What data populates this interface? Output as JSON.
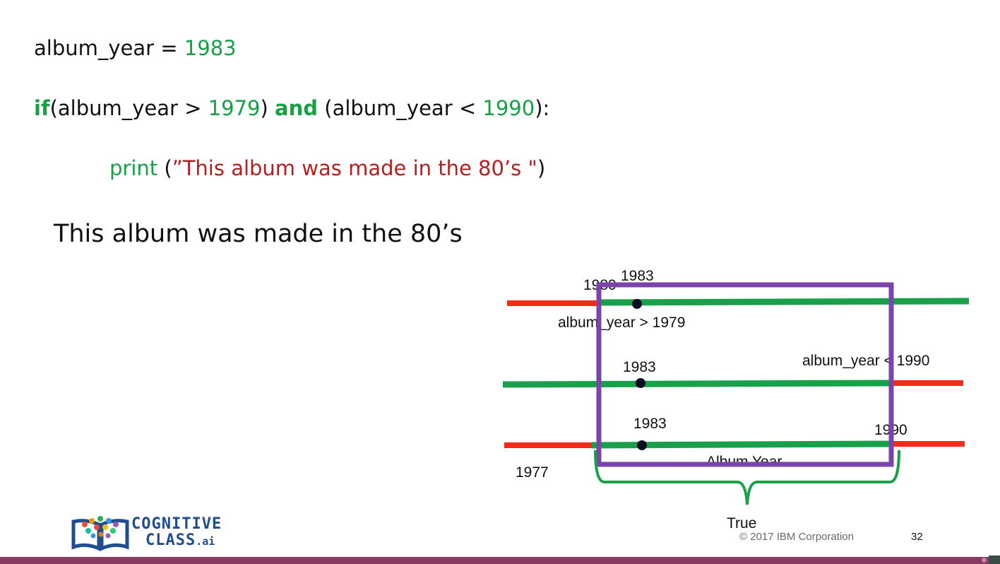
{
  "code": {
    "line1": {
      "var": "album_year = ",
      "value": "1983"
    },
    "line2": {
      "kw_if": "if",
      "p1": "(album_year > ",
      "n1": "1979",
      "p2": ") ",
      "kw_and": "and",
      "p3": " (album_year < ",
      "n2": "1990",
      "p4": "):"
    },
    "line3": {
      "fn": "print",
      "open": " (",
      "str": "”This album was made in the 80’s \"",
      "close": ")"
    }
  },
  "output": {
    "text": "This album was made in the 80’s"
  },
  "diagram": {
    "colors": {
      "true": "#1aa04a",
      "false": "#f52a1a",
      "box": "#7a44a8",
      "brace": "#1aa04a",
      "dot": "#0b0b22"
    },
    "row1": {
      "left_label": "1980",
      "value_label": "1983",
      "condition": "album_year > 1979"
    },
    "row2": {
      "value_label": "1983",
      "condition": "album_year < 1990"
    },
    "row3": {
      "value_label": "1983",
      "end_label": "1990",
      "axis_label": "Album Year",
      "start_label": "1977"
    },
    "result": "True"
  },
  "footer": {
    "logo_line1": "COGNITIVE",
    "logo_line2": "CLASS",
    "logo_suffix": ".ai",
    "copyright": "© 2017 IBM Corporation",
    "page": "32"
  }
}
